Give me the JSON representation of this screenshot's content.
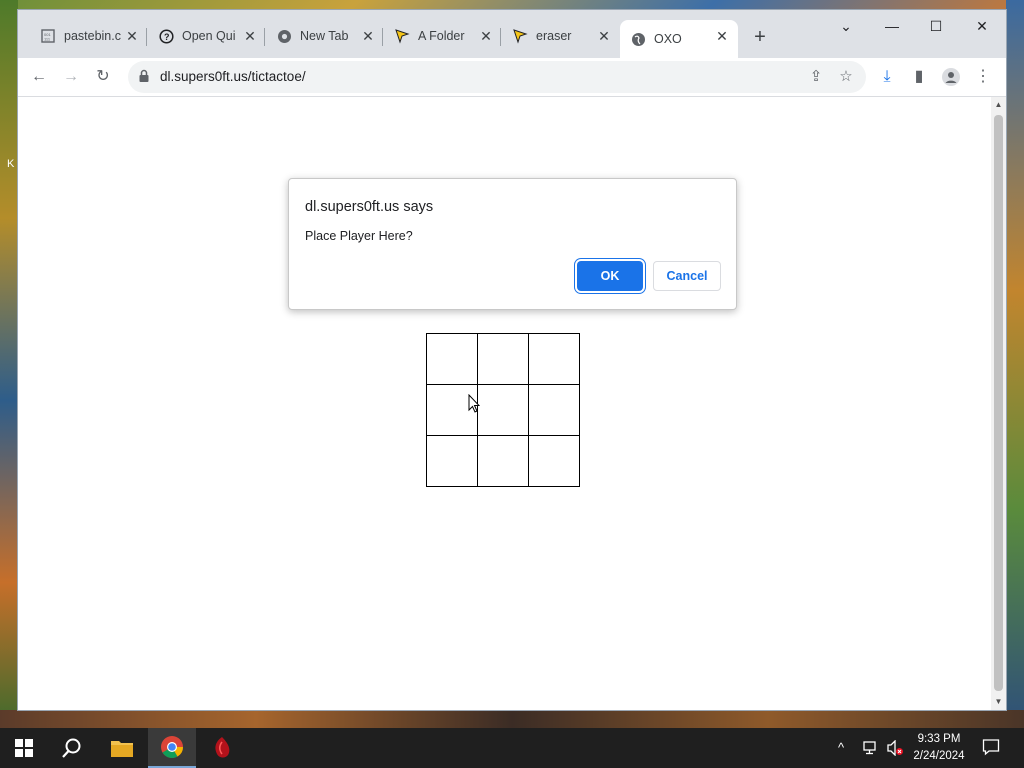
{
  "desktop": {
    "edge_text": "K"
  },
  "tabs": [
    {
      "title": "pastebin.c",
      "icon": "pastebin-icon"
    },
    {
      "title": "Open Qui",
      "icon": "help-circle-icon"
    },
    {
      "title": "New Tab",
      "icon": "chrome-icon"
    },
    {
      "title": "A Folder",
      "icon": "arrow-cursor-icon"
    },
    {
      "title": "eraser",
      "icon": "arrow-cursor-icon"
    },
    {
      "title": "OXO",
      "icon": "globe-icon"
    }
  ],
  "omnibox": {
    "url": "dl.supers0ft.us/tictactoe/"
  },
  "dialog": {
    "title": "dl.supers0ft.us says",
    "message": "Place Player Here?",
    "ok_label": "OK",
    "cancel_label": "Cancel"
  },
  "board": {
    "rows": 3,
    "cols": 3,
    "cells": [
      "",
      "",
      "",
      "",
      "",
      "",
      "",
      "",
      ""
    ]
  },
  "clock": {
    "time": "9:33 PM",
    "date": "2/24/2024"
  },
  "colors": {
    "accent": "#1a73e8",
    "tabstrip": "#dee1e6"
  }
}
